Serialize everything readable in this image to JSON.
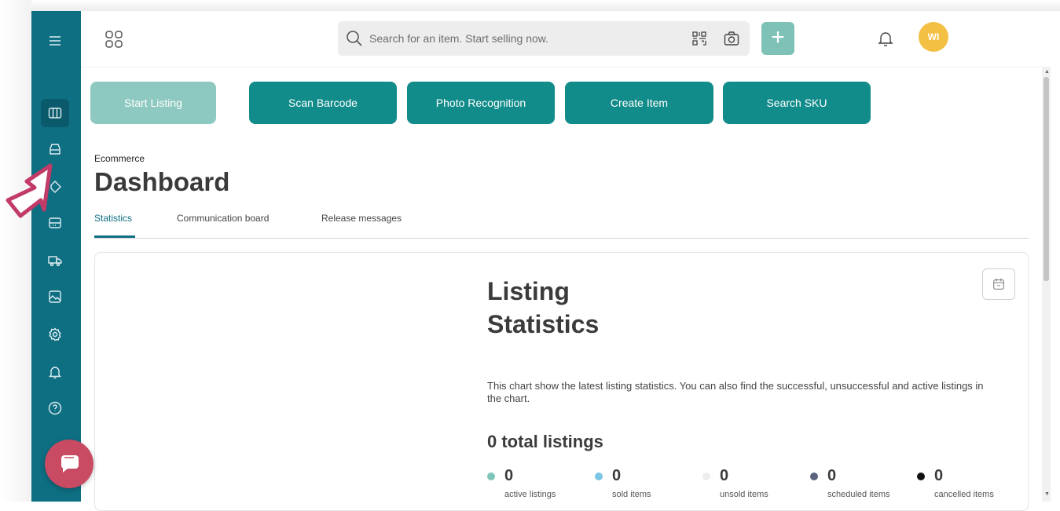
{
  "topbar": {
    "search_placeholder": "Search for an item. Start selling now.",
    "avatar_initials": "WI"
  },
  "actions": [
    {
      "label": "Start Listing"
    },
    {
      "label": "Scan Barcode"
    },
    {
      "label": "Photo Recognition"
    },
    {
      "label": "Create Item"
    },
    {
      "label": "Search SKU"
    }
  ],
  "page": {
    "breadcrumb": "Ecommerce",
    "title": "Dashboard"
  },
  "tabs": [
    {
      "label": "Statistics"
    },
    {
      "label": "Communication board"
    },
    {
      "label": "Release messages"
    }
  ],
  "card": {
    "title": "Listing\nStatistics",
    "description": "This chart show the latest listing statistics. You can also find the successful, unsuccessful and active listings in the chart.",
    "total": "0 total listings",
    "stats": [
      {
        "value": "0",
        "label": "active listings",
        "color": "#7ec4b8"
      },
      {
        "value": "0",
        "label": "sold items",
        "color": "#7cc5e4"
      },
      {
        "value": "0",
        "label": "unsold items",
        "color": "#eeeeee"
      },
      {
        "value": "0",
        "label": "scheduled items",
        "color": "#5b6380"
      },
      {
        "value": "0",
        "label": "cancelled items",
        "color": "#111111"
      }
    ]
  },
  "colors": {
    "sidebar": "#0e6e82",
    "accent": "#128c8a",
    "accent_light": "#8dc9c0",
    "avatar": "#f4c044",
    "chat": "#c84a63"
  },
  "sidebar_icons": [
    "menu-icon",
    "columns-icon",
    "inbox-icon",
    "tag-icon",
    "card-icon",
    "truck-icon",
    "image-icon",
    "gear-icon",
    "bell-icon",
    "help-icon"
  ]
}
